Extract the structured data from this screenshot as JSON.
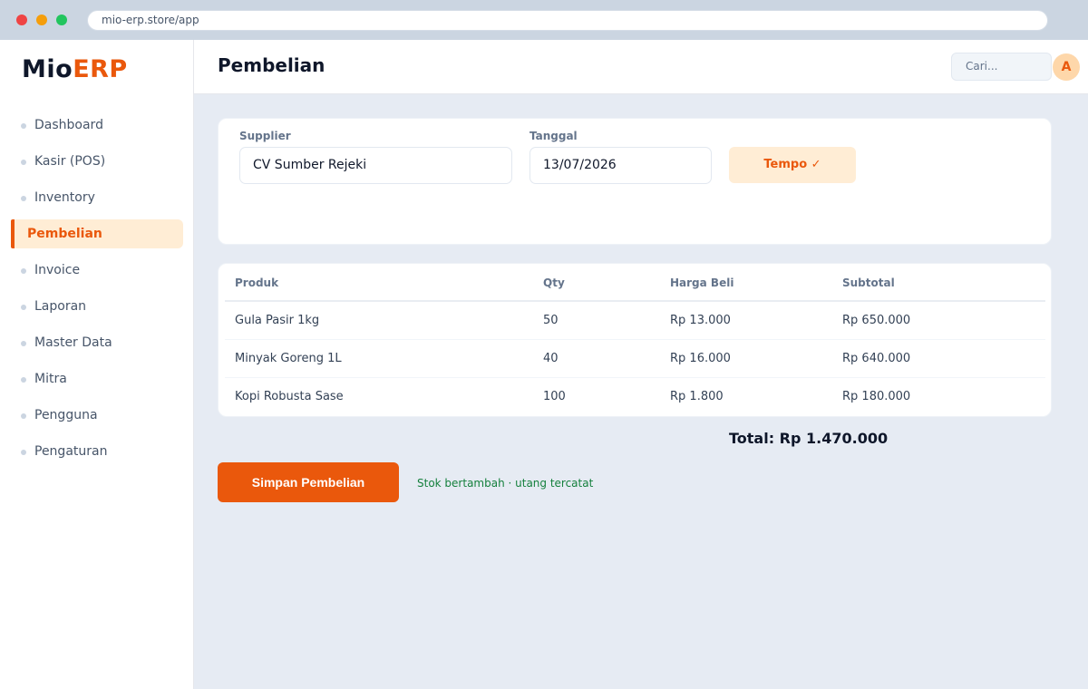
{
  "browser": {
    "url": "mio-erp.store/app"
  },
  "brand": {
    "name_part1": "Mio",
    "name_part2": "ERP",
    "accent": "#ea580c"
  },
  "sidebar": {
    "items": [
      {
        "label": "Dashboard",
        "active": false
      },
      {
        "label": "Kasir (POS)",
        "active": false
      },
      {
        "label": "Inventory",
        "active": false
      },
      {
        "label": "Pembelian",
        "active": true
      },
      {
        "label": "Invoice",
        "active": false
      },
      {
        "label": "Laporan",
        "active": false
      },
      {
        "label": "Master Data",
        "active": false
      },
      {
        "label": "Mitra",
        "active": false
      },
      {
        "label": "Pengguna",
        "active": false
      },
      {
        "label": "Pengaturan",
        "active": false
      }
    ]
  },
  "header": {
    "title": "Pembelian",
    "search_placeholder": "Cari...",
    "avatar_initial": "A"
  },
  "form": {
    "supplier_label": "Supplier",
    "supplier_value": "CV Sumber Rejeki",
    "date_label": "Tanggal",
    "date_value": "13/07/2026",
    "tempo_label": "Tempo ✓"
  },
  "table": {
    "headers": [
      "Produk",
      "Qty",
      "Harga Beli",
      "Subtotal"
    ],
    "rows": [
      [
        "Gula Pasir 1kg",
        "50",
        "Rp 13.000",
        "Rp 650.000"
      ],
      [
        "Minyak Goreng 1L",
        "40",
        "Rp 16.000",
        "Rp 640.000"
      ],
      [
        "Kopi Robusta Sase",
        "100",
        "Rp 1.800",
        "Rp 180.000"
      ]
    ]
  },
  "summary": {
    "total": "Total: Rp 1.470.000"
  },
  "actions": {
    "save_label": "Simpan Pembelian",
    "status_text": "Stok bertambah · utang tercatat"
  }
}
